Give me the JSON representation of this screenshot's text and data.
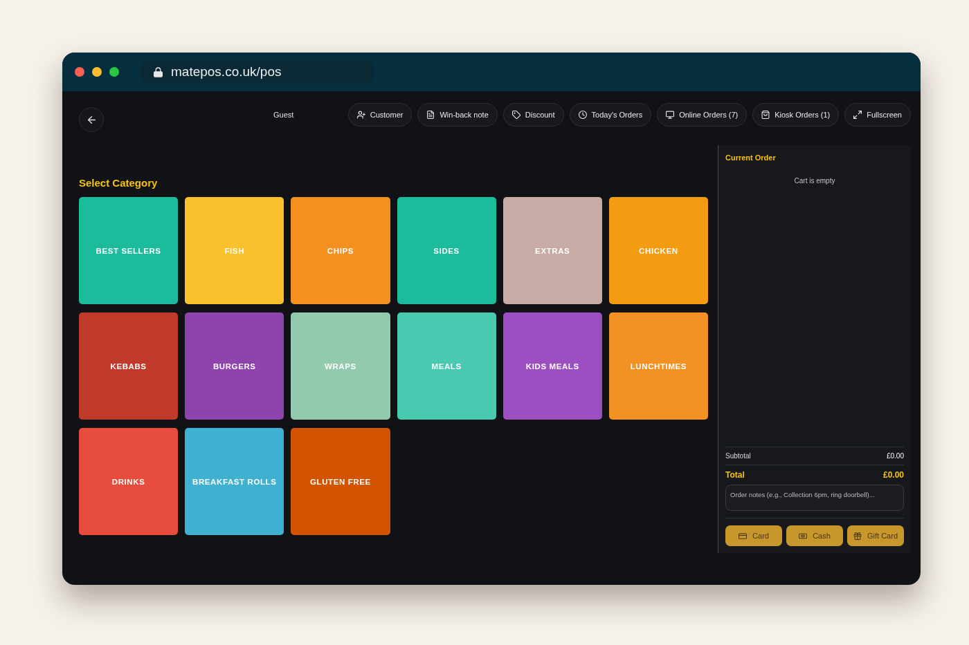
{
  "browser": {
    "url": "matepos.co.uk/pos"
  },
  "header": {
    "customer": "Guest",
    "actions": [
      "Customer",
      "Win-back note",
      "Discount",
      "Today's Orders",
      "Online Orders (7)",
      "Kiosk Orders (1)",
      "Fullscreen"
    ]
  },
  "categories": {
    "title": "Select Category",
    "items": [
      {
        "label": "BEST SELLERS",
        "color": "#1abc9c"
      },
      {
        "label": "FISH",
        "color": "#fbc02d"
      },
      {
        "label": "CHIPS",
        "color": "#f39020"
      },
      {
        "label": "SIDES",
        "color": "#1abc9c"
      },
      {
        "label": "EXTRAS",
        "color": "#c8aba4"
      },
      {
        "label": "CHICKEN",
        "color": "#f39c12"
      },
      {
        "label": "KEBABS",
        "color": "#c0392b"
      },
      {
        "label": "BURGERS",
        "color": "#8e44ad"
      },
      {
        "label": "WRAPS",
        "color": "#93c9ad"
      },
      {
        "label": "MEALS",
        "color": "#48c9b0"
      },
      {
        "label": "KIDS MEALS",
        "color": "#9b4fc0"
      },
      {
        "label": "LUNCHTIMES",
        "color": "#f39222"
      },
      {
        "label": "DRINKS",
        "color": "#e74c3c"
      },
      {
        "label": "BREAKFAST ROLLS",
        "color": "#3fb0d0"
      },
      {
        "label": "GLUTEN FREE",
        "color": "#d35400"
      }
    ]
  },
  "order": {
    "title": "Current Order",
    "empty_message": "Cart is empty",
    "subtotal": {
      "label": "Subtotal",
      "value": "£0.00"
    },
    "total": {
      "label": "Total",
      "value": "£0.00"
    },
    "notes": {
      "placeholder": "Order notes (e.g., Collection 6pm, ring doorbell)..."
    },
    "payments": [
      "Card",
      "Cash",
      "Gift Card"
    ]
  }
}
